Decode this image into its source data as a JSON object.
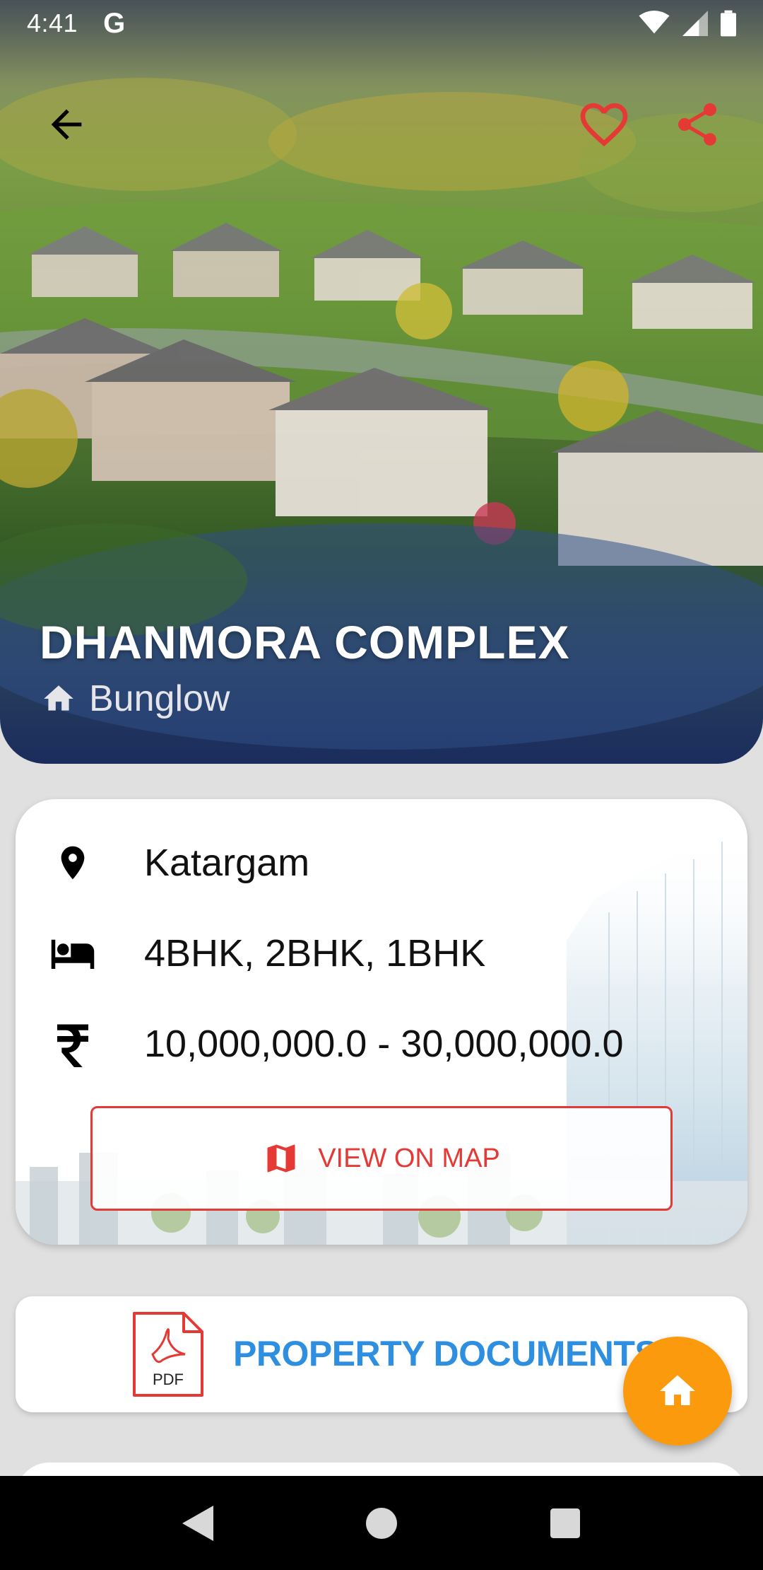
{
  "status_bar": {
    "time": "4:41",
    "carrier_icon": "google-g-icon",
    "icons": [
      "wifi-icon",
      "signal-icon",
      "battery-icon"
    ]
  },
  "header": {
    "back_icon": "arrow-back-icon",
    "favorite_icon": "heart-outline-icon",
    "share_icon": "share-icon",
    "accent_color": "#e53935"
  },
  "property": {
    "title": "DHANMORA COMPLEX",
    "type_icon": "home-icon",
    "type": "Bunglow"
  },
  "details": {
    "location_icon": "location-pin-icon",
    "location": "Katargam",
    "bedroom_icon": "bed-icon",
    "configurations": "4BHK, 2BHK, 1BHK",
    "price_icon": "rupee-icon",
    "price_range": "10,000,000.0 - 30,000,000.0",
    "map_button_label": "VIEW ON MAP",
    "map_icon": "map-icon"
  },
  "documents": {
    "icon": "pdf-icon",
    "icon_text": "PDF",
    "label": "PROPERTY DOCUMENTS",
    "label_color": "#2e8fe0"
  },
  "fab": {
    "icon": "home-icon",
    "color": "#fb9a0c"
  },
  "nav": {
    "back_icon": "nav-back-icon",
    "home_icon": "nav-home-icon",
    "recents_icon": "nav-recents-icon"
  }
}
